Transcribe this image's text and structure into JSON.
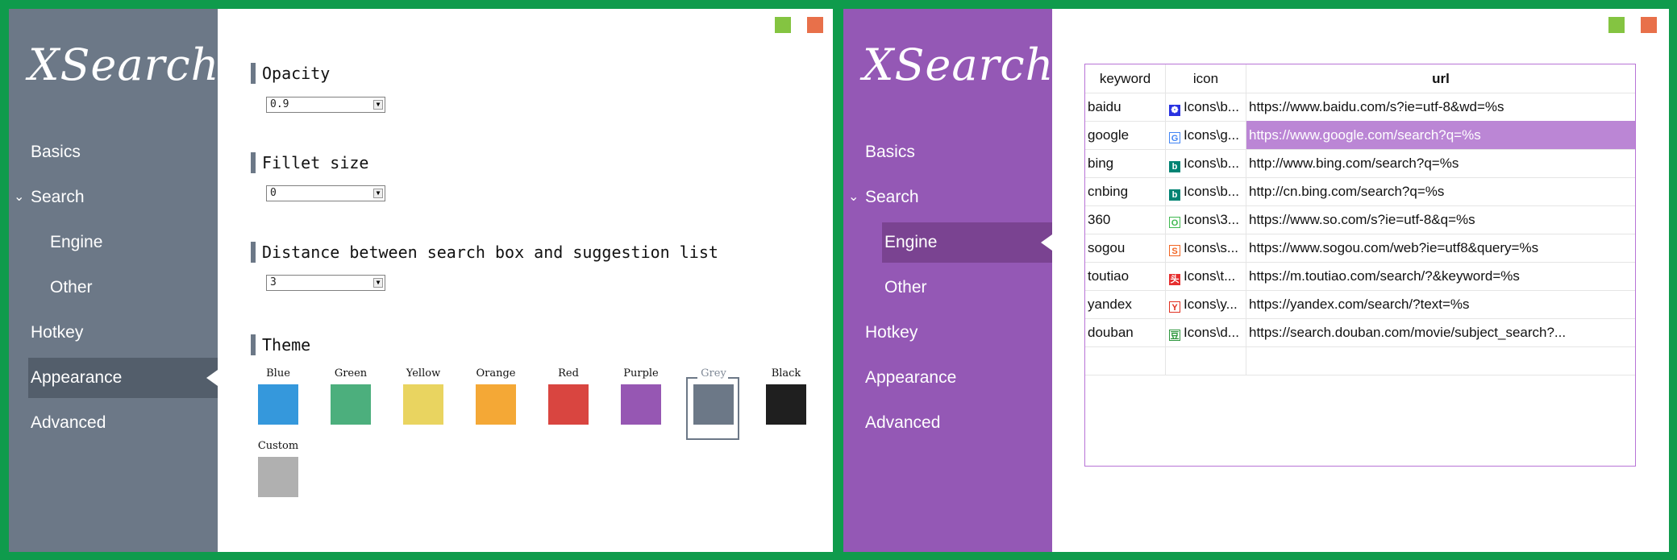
{
  "left_window": {
    "logo": "XSearch",
    "nav": {
      "basics": "Basics",
      "search": "Search",
      "engine": "Engine",
      "other": "Other",
      "hotkey": "Hotkey",
      "appearance": "Appearance",
      "advanced": "Advanced",
      "active": "appearance"
    },
    "colors": {
      "sidebar": "#6c7887",
      "minimize": "#84c441",
      "close": "#e8704a"
    },
    "settings": {
      "opacity": {
        "label": "Opacity",
        "value": "0.9"
      },
      "fillet": {
        "label": "Fillet size",
        "value": "0"
      },
      "distance": {
        "label": "Distance between search box and suggestion list",
        "value": "3"
      },
      "theme": {
        "label": "Theme",
        "selected": "Grey",
        "swatches": [
          {
            "name": "Blue",
            "color": "#3598dc"
          },
          {
            "name": "Green",
            "color": "#4caf7d"
          },
          {
            "name": "Yellow",
            "color": "#e9d460"
          },
          {
            "name": "Orange",
            "color": "#f4a836"
          },
          {
            "name": "Red",
            "color": "#d94540"
          },
          {
            "name": "Purple",
            "color": "#9657b3"
          },
          {
            "name": "Grey",
            "color": "#6c7887"
          },
          {
            "name": "Black",
            "color": "#1f1f1f"
          },
          {
            "name": "Custom",
            "color": "#b0b0b0"
          }
        ]
      }
    }
  },
  "right_window": {
    "logo": "XSearch",
    "nav": {
      "basics": "Basics",
      "search": "Search",
      "engine": "Engine",
      "other": "Other",
      "hotkey": "Hotkey",
      "appearance": "Appearance",
      "advanced": "Advanced",
      "active": "engine"
    },
    "colors": {
      "sidebar": "#9458b5",
      "minimize": "#84c441",
      "close": "#e8704a"
    },
    "table": {
      "headers": {
        "keyword": "keyword",
        "icon": "icon",
        "url": "url"
      },
      "selected_row": 1,
      "rows": [
        {
          "keyword": "baidu",
          "icon": "Icons\\b...",
          "icon_name": "baidu-icon",
          "url": "https://www.baidu.com/s?ie=utf-8&wd=%s"
        },
        {
          "keyword": "google",
          "icon": "Icons\\g...",
          "icon_name": "google-icon",
          "url": "https://www.google.com/search?q=%s"
        },
        {
          "keyword": "bing",
          "icon": "Icons\\b...",
          "icon_name": "bing-icon",
          "url": "http://www.bing.com/search?q=%s"
        },
        {
          "keyword": "cnbing",
          "icon": "Icons\\b...",
          "icon_name": "bing-icon",
          "url": "http://cn.bing.com/search?q=%s"
        },
        {
          "keyword": "360",
          "icon": "Icons\\3...",
          "icon_name": "360-icon",
          "url": "https://www.so.com/s?ie=utf-8&q=%s"
        },
        {
          "keyword": "sogou",
          "icon": "Icons\\s...",
          "icon_name": "sogou-icon",
          "url": "https://www.sogou.com/web?ie=utf8&query=%s"
        },
        {
          "keyword": "toutiao",
          "icon": "Icons\\t...",
          "icon_name": "toutiao-icon",
          "url": "https://m.toutiao.com/search/?&keyword=%s"
        },
        {
          "keyword": "yandex",
          "icon": "Icons\\y...",
          "icon_name": "yandex-icon",
          "url": "https://yandex.com/search/?text=%s"
        },
        {
          "keyword": "douban",
          "icon": "Icons\\d...",
          "icon_name": "douban-icon",
          "url": "https://search.douban.com/movie/subject_search?..."
        }
      ]
    }
  }
}
